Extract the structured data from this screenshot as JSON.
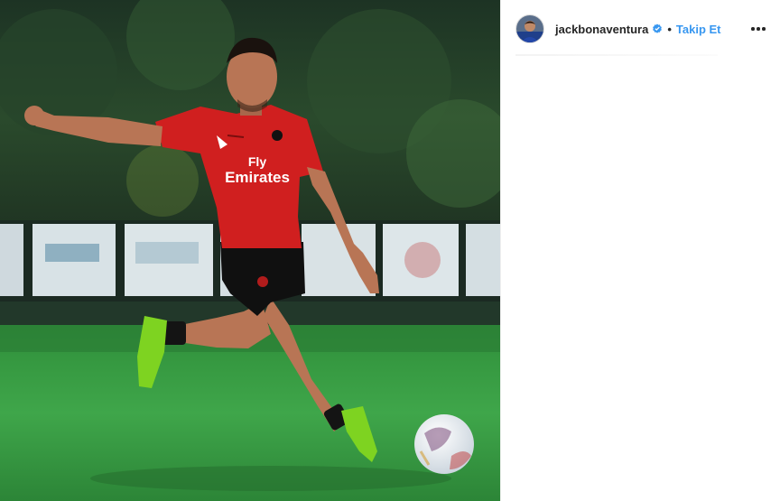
{
  "post": {
    "image_alt": "AC Milan player kicking a football on a training pitch",
    "jersey_text_line1": "Fly",
    "jersey_text_line2": "Emirates"
  },
  "header": {
    "username": "jackbonaventura",
    "separator": "•",
    "follow_label": "Takip Et"
  },
  "colors": {
    "accent": "#3897f0",
    "verified_badge": "#3897f0",
    "text": "#262626"
  },
  "icons": {
    "verified": "verified-badge-icon",
    "more": "more-options-icon"
  }
}
